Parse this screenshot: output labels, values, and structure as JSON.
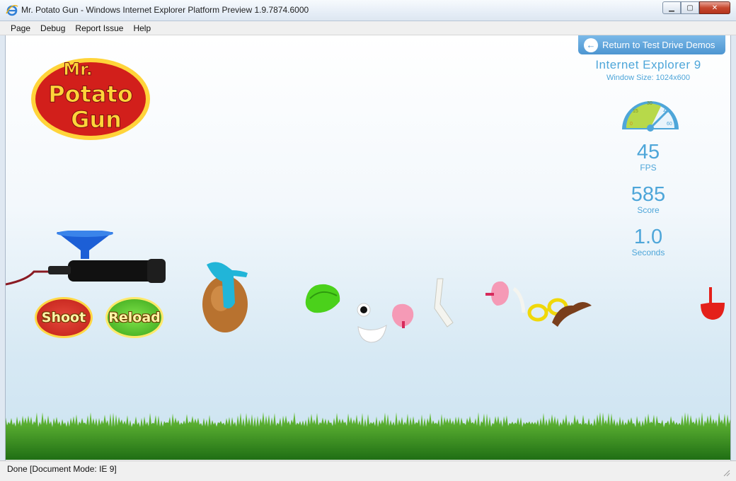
{
  "window": {
    "title": "Mr. Potato Gun - Windows Internet Explorer Platform Preview 1.9.7874.6000",
    "icon": "ie-icon",
    "controls": {
      "minimize": "▁",
      "maximize": "▢",
      "close": "✕"
    }
  },
  "menu": {
    "items": [
      {
        "label": "Page"
      },
      {
        "label": "Debug"
      },
      {
        "label": "Report Issue"
      },
      {
        "label": "Help"
      }
    ]
  },
  "game": {
    "logo_text": [
      "Mr.",
      "Potato",
      "Gun"
    ],
    "return_button": "Return to Test Drive Demos",
    "browser_name": "Internet Explorer 9",
    "window_size": "Window Size: 1024x600",
    "gauge": {
      "ticks": [
        "0",
        "15",
        "30",
        "45",
        "60"
      ],
      "value": 45,
      "max": 60
    },
    "fps": {
      "value": "45",
      "label": "FPS"
    },
    "score": {
      "value": "585",
      "label": "Score"
    },
    "seconds": {
      "value": "1.0",
      "label": "Seconds"
    },
    "shoot_button": "Shoot",
    "reload_button": "Reload",
    "parts": [
      "potato-body",
      "blue-hat",
      "green-hat",
      "eye",
      "mouth",
      "pink-ear",
      "arm",
      "pink-ear",
      "glasses",
      "mustache",
      "red-shoe"
    ]
  },
  "status": {
    "text": "Done [Document Mode: IE 9]"
  },
  "colors": {
    "accent": "#4ea6d9",
    "return_button": "#5aa1d8",
    "shoot": "#d1281e",
    "reload": "#4fc22a"
  }
}
